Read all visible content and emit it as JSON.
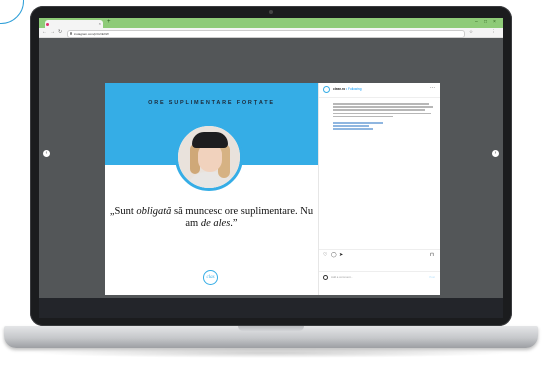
{
  "browser": {
    "tab_title": "",
    "new_tab": "+",
    "window_controls": {
      "minimize": "–",
      "maximize": "□",
      "close": "×"
    },
    "nav": {
      "back": "←",
      "forward": "→",
      "reload": "↻"
    },
    "url": "instagram.com/p/C2rEXW",
    "toolbar_icons": [
      "☆",
      "⋮"
    ]
  },
  "viewer": {
    "prev": "‹",
    "next": "›"
  },
  "post": {
    "title": "ORE SUPLIMENTARE FORȚATE",
    "quote_part1": "„Sunt ",
    "quote_em1": "obligată",
    "quote_part2": " să muncesc ore suplimentare. Nu am ",
    "quote_em2": "de ales",
    "quote_part3": ".”",
    "caption": "",
    "logo_text": "clas"
  },
  "sidebar": {
    "handle": "clean.ro",
    "follow": "• Following",
    "more": "···",
    "caption_handle": "",
    "time": "",
    "likes": "",
    "date": "",
    "comment_placeholder": "Add a comment...",
    "post_button": "Post",
    "actions": {
      "like": "♡",
      "comment": "◯",
      "share": "➤",
      "save": "⊓"
    }
  },
  "taskbar": {
    "weather": "",
    "clock": ""
  },
  "colors": {
    "accent": "#35ade6",
    "tabbar": "#8ecb78",
    "laptop_bezel": "#1b1c1e"
  }
}
